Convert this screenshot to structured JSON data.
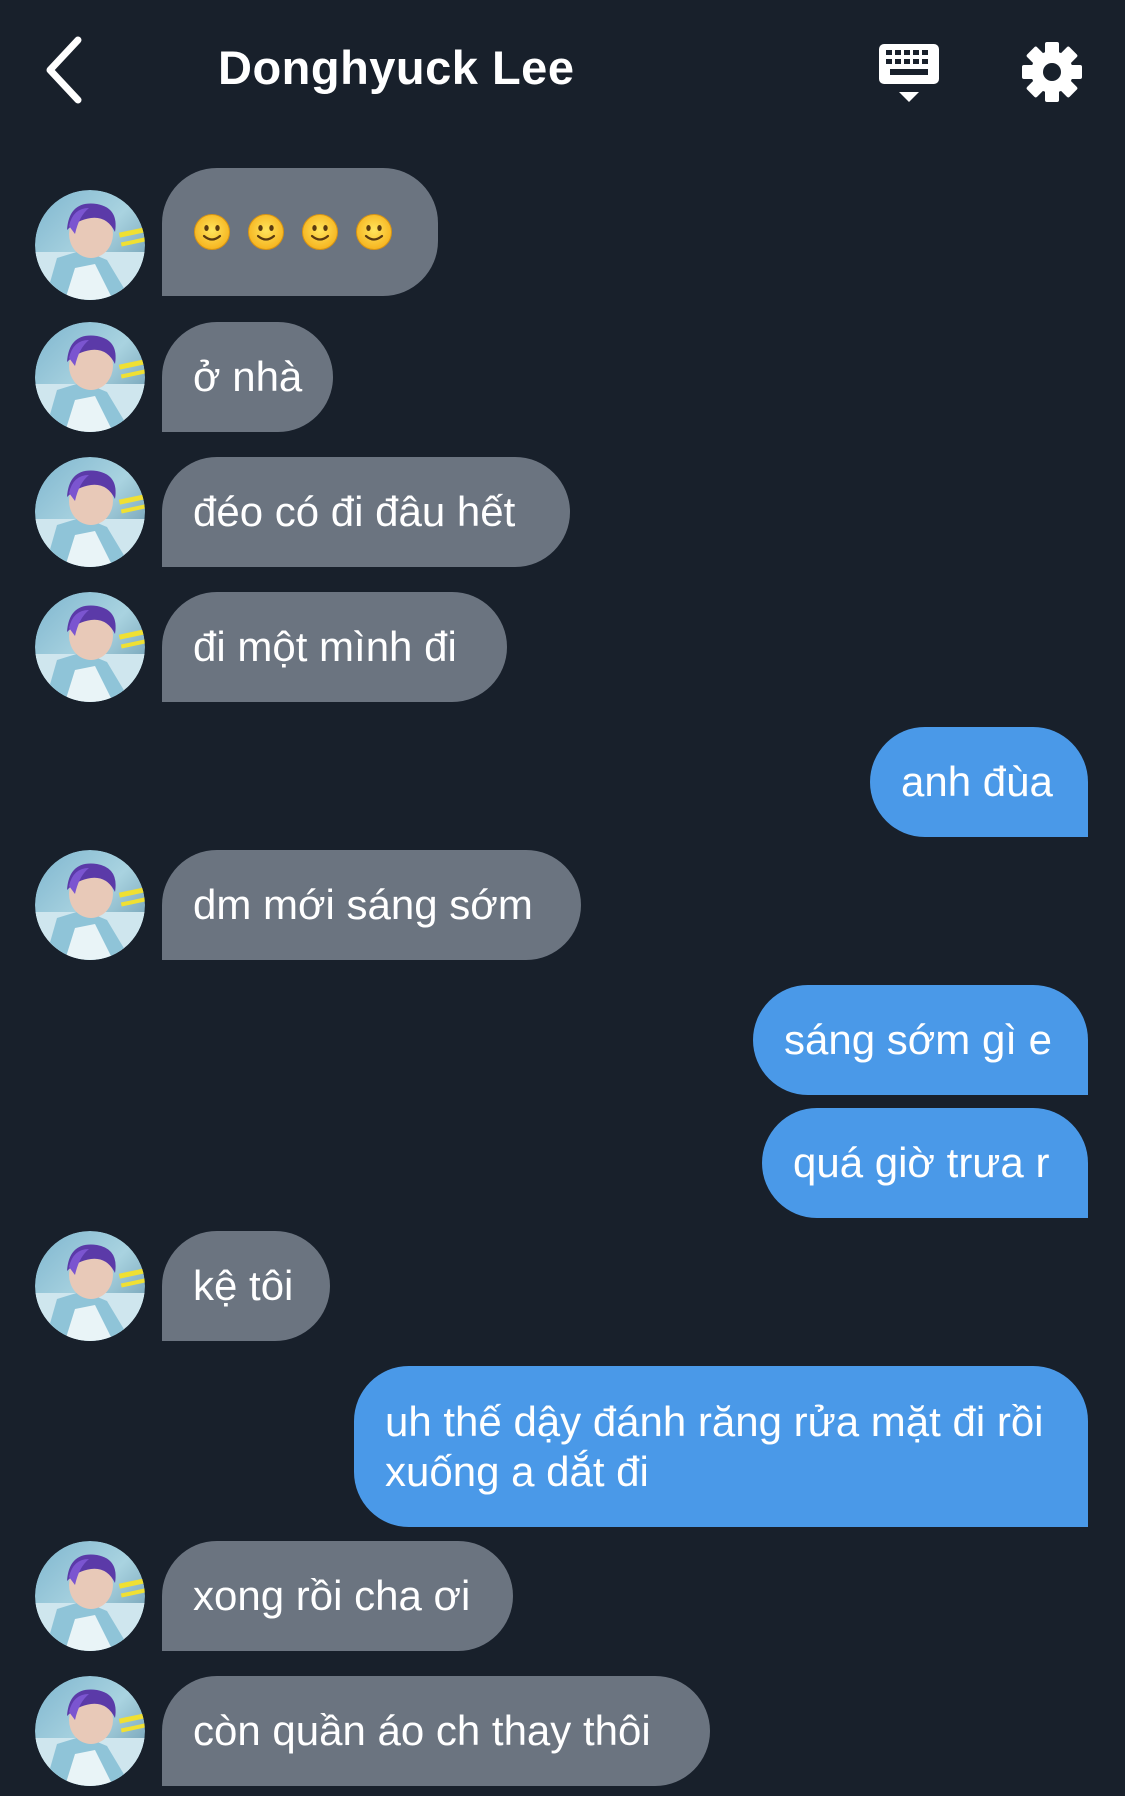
{
  "header": {
    "title": "Donghyuck Lee",
    "icons": {
      "back": "chevron-left-icon",
      "keyboard": "keyboard-icon",
      "settings": "gear-icon"
    }
  },
  "colors": {
    "background": "#18202b",
    "incoming_bubble": "#6b7480",
    "outgoing_bubble": "#4a99e8",
    "text": "#ffffff"
  },
  "messages": [
    {
      "direction": "in",
      "type": "emoji",
      "emoji_count": 4,
      "emoji": "slightly-smiling-face"
    },
    {
      "direction": "in",
      "text": "ở nhà"
    },
    {
      "direction": "in",
      "text": "đéo có đi đâu hết"
    },
    {
      "direction": "in",
      "text": "đi một mình đi"
    },
    {
      "direction": "out",
      "text": "anh đùa"
    },
    {
      "direction": "in",
      "text": "dm mới sáng sớm"
    },
    {
      "direction": "out",
      "text": "sáng sớm gì e"
    },
    {
      "direction": "out",
      "text": "quá giờ trưa r"
    },
    {
      "direction": "in",
      "text": "kệ tôi"
    },
    {
      "direction": "out",
      "text": "uh thế dậy đánh răng rửa mặt đi rồi xuống a dắt đi"
    },
    {
      "direction": "in",
      "text": "xong rồi cha ơi"
    },
    {
      "direction": "in",
      "text": "còn quần áo ch thay thôi"
    }
  ]
}
